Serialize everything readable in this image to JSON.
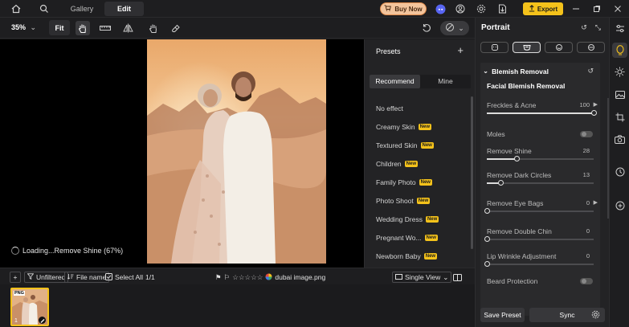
{
  "topbar": {
    "tabs": [
      {
        "label": "Gallery"
      },
      {
        "label": "Edit"
      }
    ],
    "buy_now": "Buy Now",
    "export": "Export"
  },
  "toolbar": {
    "zoom": "35%",
    "fit": "Fit"
  },
  "canvas": {
    "loading_text": "Loading...Remove Shine (67%)"
  },
  "presets": {
    "title": "Presets",
    "tabs": [
      "Recommend",
      "Mine"
    ],
    "badge": "New",
    "items": [
      {
        "label": "No effect",
        "new": false
      },
      {
        "label": "Creamy Skin",
        "new": true
      },
      {
        "label": "Textured Skin",
        "new": true
      },
      {
        "label": "Children",
        "new": true
      },
      {
        "label": "Family Photo",
        "new": true
      },
      {
        "label": "Photo Shoot",
        "new": true
      },
      {
        "label": "Wedding Dress",
        "new": true
      },
      {
        "label": "Pregnant Wo...",
        "new": true
      },
      {
        "label": "Newborn Baby",
        "new": true
      }
    ]
  },
  "bottombar": {
    "filter": "Unfiltered",
    "sort": "File name",
    "select_all": "Select All",
    "count": "1/1",
    "filename": "dubai image.png",
    "view": "Single View"
  },
  "thumb": {
    "badge": "PNG",
    "index": "1"
  },
  "portrait": {
    "title": "Portrait",
    "section_title": "Blemish Removal",
    "subsection": "Facial Blemish Removal",
    "controls": [
      {
        "label": "Freckles & Acne",
        "value": "100",
        "level": 1.0,
        "arrow": true
      },
      {
        "label": "Moles",
        "toggle": true
      },
      {
        "label": "Remove Shine",
        "value": "28",
        "level": 0.28
      },
      {
        "label": "Remove Dark Circles",
        "value": "13",
        "level": 0.13
      },
      {
        "label": "Remove Eye Bags",
        "value": "0",
        "level": 0.0,
        "arrow": true
      },
      {
        "label": "Remove Double Chin",
        "value": "0",
        "level": 0.0
      },
      {
        "label": "Lip Wrinkle Adjustment",
        "value": "0",
        "level": 0.0
      },
      {
        "label": "Beard Protection",
        "toggle": true
      }
    ],
    "save_preset": "Save Preset",
    "sync": "Sync"
  },
  "colors": {
    "accent": "#f4c21b",
    "buy_bg": "#f3c49c",
    "panel": "#232325"
  }
}
